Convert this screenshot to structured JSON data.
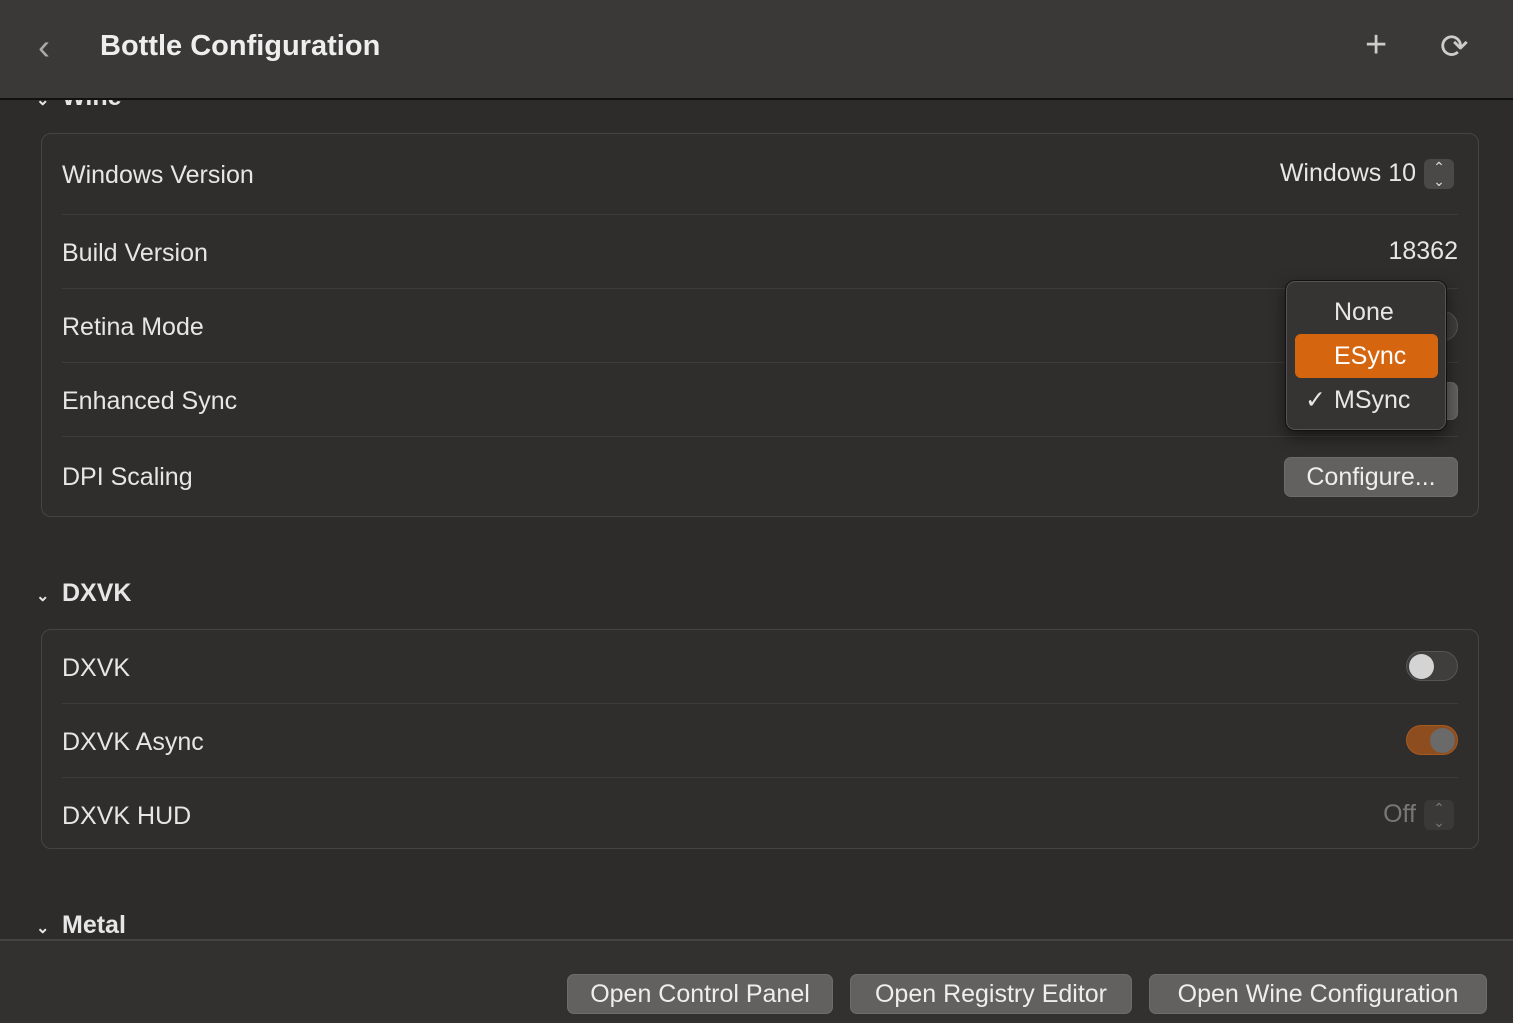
{
  "header": {
    "title": "Bottle Configuration",
    "back_icon": "chevron-left-icon",
    "add_icon": "plus-icon",
    "refresh_icon": "refresh-icon"
  },
  "wine": {
    "title": "Wine",
    "rows": [
      {
        "label": "Windows Version",
        "value": "Windows 10"
      },
      {
        "label": "Build Version",
        "value": "18362"
      },
      {
        "label": "Retina Mode",
        "toggle": false
      },
      {
        "label": "Enhanced Sync"
      },
      {
        "label": "DPI Scaling",
        "button": "Configure..."
      }
    ]
  },
  "sync_menu": {
    "options": [
      "None",
      "ESync",
      "MSync"
    ],
    "highlighted": "ESync",
    "selected": "MSync",
    "highlight_color": "#d5660f"
  },
  "dxvk": {
    "title": "DXVK",
    "rows": [
      {
        "label": "DXVK",
        "toggle": false
      },
      {
        "label": "DXVK Async",
        "toggle": true
      },
      {
        "label": "DXVK HUD",
        "value": "Off"
      }
    ]
  },
  "metal": {
    "title": "Metal"
  },
  "footer": {
    "control_panel": "Open Control Panel",
    "registry": "Open Registry Editor",
    "winecfg": "Open Wine Configuration"
  }
}
